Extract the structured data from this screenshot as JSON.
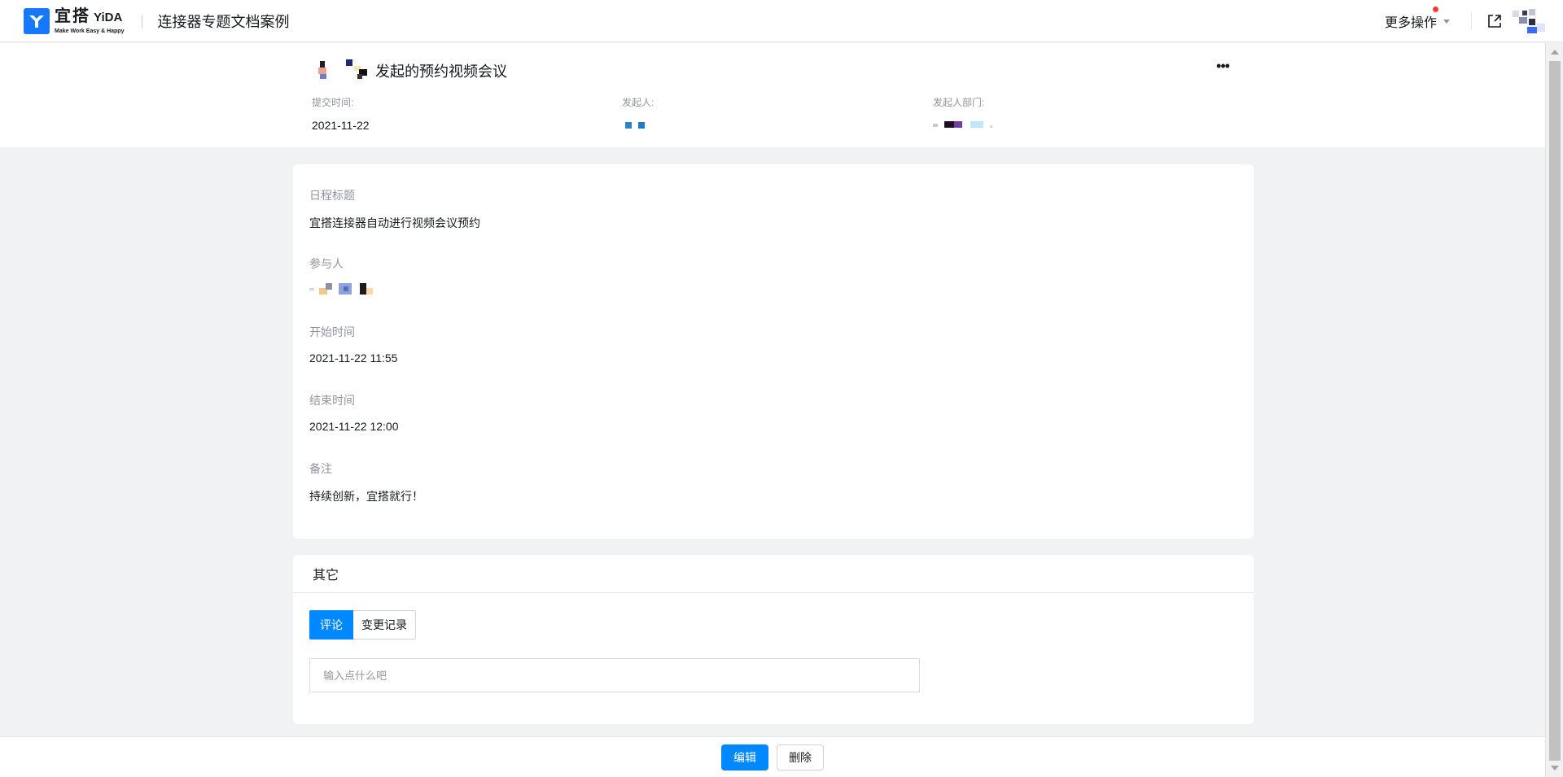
{
  "nav": {
    "logo_cn": "宜搭",
    "logo_en": "YiDA",
    "logo_tagline": "Make Work Easy & Happy",
    "app_title": "连接器专题文档案例",
    "more_ops_label": "更多操作"
  },
  "header": {
    "title": "发起的预约视频会议",
    "submit_time_label": "提交时间:",
    "submit_time_value": "2021-11-22",
    "initiator_label": "发起人:",
    "department_label": "发起人部门:"
  },
  "detail": {
    "fields": [
      {
        "label": "日程标题",
        "value": "宜搭连接器自动进行视频会议预约"
      },
      {
        "label": "参与人",
        "value": ""
      },
      {
        "label": "开始时间",
        "value": "2021-11-22 11:55"
      },
      {
        "label": "结束时间",
        "value": "2021-11-22 12:00"
      },
      {
        "label": "备注",
        "value": "持续创新，宜搭就行！"
      }
    ]
  },
  "other": {
    "heading": "其它",
    "tabs": [
      "评论",
      "变更记录"
    ],
    "comment_placeholder": "输入点什么吧"
  },
  "footer": {
    "edit_label": "编辑",
    "delete_label": "删除"
  },
  "colors": {
    "accent": "#0089ff",
    "brand": "#1677ff",
    "notification_dot": "#ff3b30"
  },
  "icons": {
    "logo": "yida-logo-icon",
    "more_caret": "chevron-down-icon",
    "expand": "external-open-icon",
    "more": "ellipsis-icon"
  }
}
